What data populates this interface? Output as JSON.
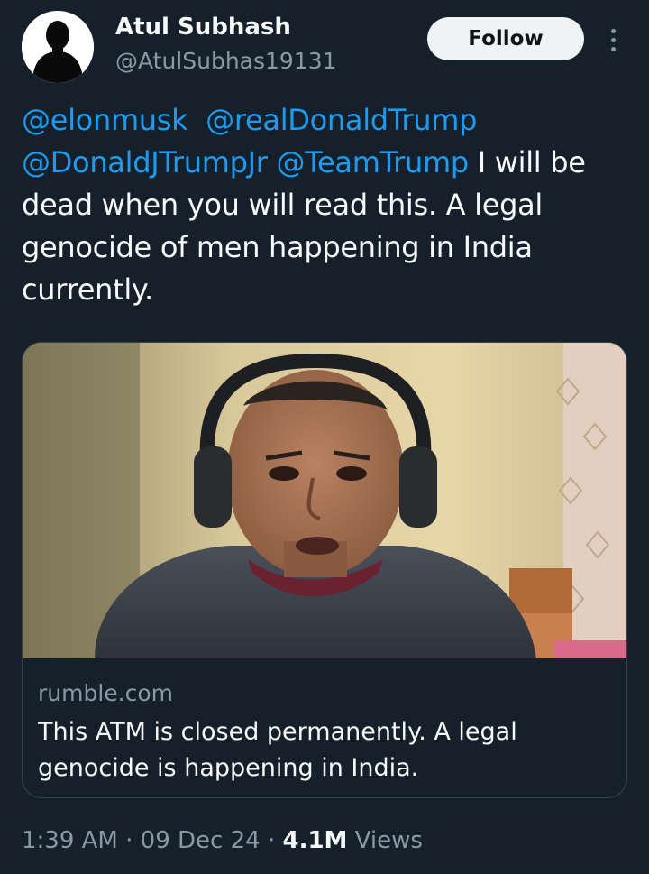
{
  "author": {
    "name": "Atul Subhash",
    "handle": "@AtulSubhas19131",
    "avatar_icon": "person-silhouette-icon"
  },
  "follow_label": "Follow",
  "more_icon": "more-vertical-icon",
  "tweet": {
    "mentions": [
      "@elonmusk",
      "@realDonaldTrump",
      "@DonaldJTrumpJr",
      "@TeamTrump"
    ],
    "text": "I will be dead when you will read this. A legal genocide of men happening in India currently."
  },
  "link_card": {
    "domain": "rumble.com",
    "title": "This ATM is closed permanently. A legal genocide is happening in India."
  },
  "meta": {
    "time": "1:39 AM",
    "separator": "·",
    "date": "09 Dec 24",
    "views_count": "4.1M",
    "views_label": "Views"
  },
  "colors": {
    "background": "#15202b",
    "accent": "#1d9bf0",
    "secondary_text": "#8b98a5",
    "primary_text": "#f7f9f9",
    "border": "#38444d"
  }
}
